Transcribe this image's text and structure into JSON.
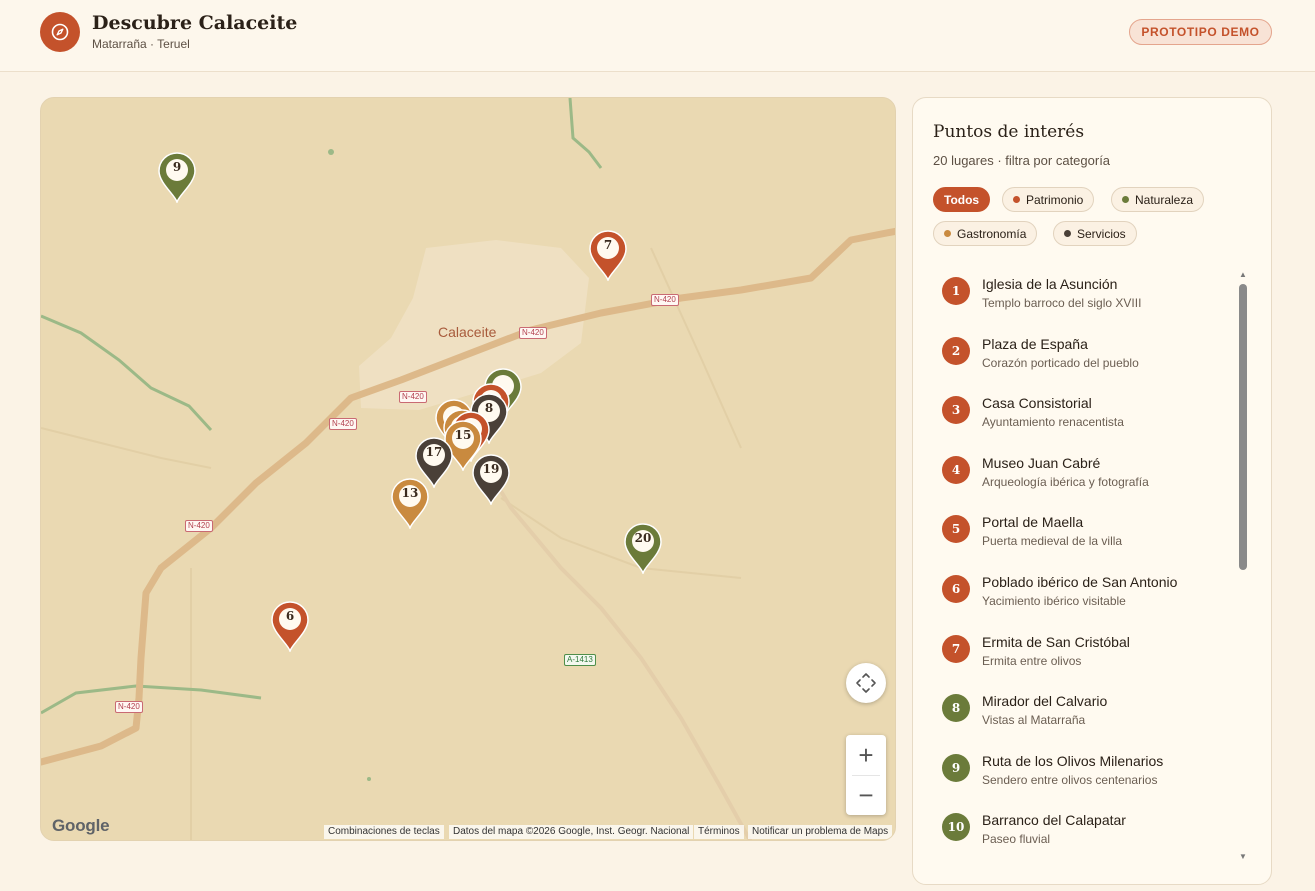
{
  "header": {
    "title": "Descubre Calaceite",
    "subtitle": "Matarraña · Teruel",
    "badge": "PROTOTIPO DEMO"
  },
  "colors": {
    "patrimonio": "#c4522b",
    "naturaleza": "#6b7b3a",
    "gastronomia": "#c98a3f",
    "servicios": "#4a4038",
    "background": "#fbf3e6",
    "map": "#ead9b2"
  },
  "map": {
    "town_label": "Calaceite",
    "roads": {
      "n420": "N-420",
      "a1413": "A-1413"
    },
    "markers": [
      {
        "label": "9",
        "category": "naturaleza"
      },
      {
        "label": "7",
        "category": "patrimonio"
      },
      {
        "label": "",
        "category": "naturaleza"
      },
      {
        "label": "",
        "category": "patrimonio"
      },
      {
        "label": "",
        "category": "gastronomia"
      },
      {
        "label": "8",
        "category": "servicios"
      },
      {
        "label": "",
        "category": "gastronomia"
      },
      {
        "label": "",
        "category": "patrimonio"
      },
      {
        "label": "15",
        "category": "gastronomia"
      },
      {
        "label": "17",
        "category": "servicios"
      },
      {
        "label": "19",
        "category": "servicios"
      },
      {
        "label": "13",
        "category": "gastronomia"
      },
      {
        "label": "20",
        "category": "naturaleza"
      },
      {
        "label": "6",
        "category": "patrimonio"
      }
    ],
    "zoom_in": "+",
    "zoom_out": "−",
    "google": "Google",
    "attribution": {
      "shortcuts": "Combinaciones de teclas",
      "data": "Datos del mapa ©2026 Google, Inst. Geogr. Nacional",
      "terms": "Términos",
      "report": "Notificar un problema de Maps"
    }
  },
  "sidebar": {
    "title": "Puntos de interés",
    "subtitle": "20 lugares · filtra por categoría",
    "filters": [
      {
        "label": "Todos",
        "active": true
      },
      {
        "label": "Patrimonio",
        "category": "patrimonio"
      },
      {
        "label": "Naturaleza",
        "category": "naturaleza"
      },
      {
        "label": "Gastronomía",
        "category": "gastronomia"
      },
      {
        "label": "Servicios",
        "category": "servicios"
      }
    ],
    "places": [
      {
        "num": "1",
        "name": "Iglesia de la Asunción",
        "desc": "Templo barroco del siglo XVIII",
        "category": "patrimonio"
      },
      {
        "num": "2",
        "name": "Plaza de España",
        "desc": "Corazón porticado del pueblo",
        "category": "patrimonio"
      },
      {
        "num": "3",
        "name": "Casa Consistorial",
        "desc": "Ayuntamiento renacentista",
        "category": "patrimonio"
      },
      {
        "num": "4",
        "name": "Museo Juan Cabré",
        "desc": "Arqueología ibérica y fotografía",
        "category": "patrimonio"
      },
      {
        "num": "5",
        "name": "Portal de Maella",
        "desc": "Puerta medieval de la villa",
        "category": "patrimonio"
      },
      {
        "num": "6",
        "name": "Poblado ibérico de San Antonio",
        "desc": "Yacimiento ibérico visitable",
        "category": "patrimonio"
      },
      {
        "num": "7",
        "name": "Ermita de San Cristóbal",
        "desc": "Ermita entre olivos",
        "category": "patrimonio"
      },
      {
        "num": "8",
        "name": "Mirador del Calvario",
        "desc": "Vistas al Matarraña",
        "category": "naturaleza"
      },
      {
        "num": "9",
        "name": "Ruta de los Olivos Milenarios",
        "desc": "Sendero entre olivos centenarios",
        "category": "naturaleza"
      },
      {
        "num": "10",
        "name": "Barranco del Calapatar",
        "desc": "Paseo fluvial",
        "category": "naturaleza"
      }
    ]
  }
}
